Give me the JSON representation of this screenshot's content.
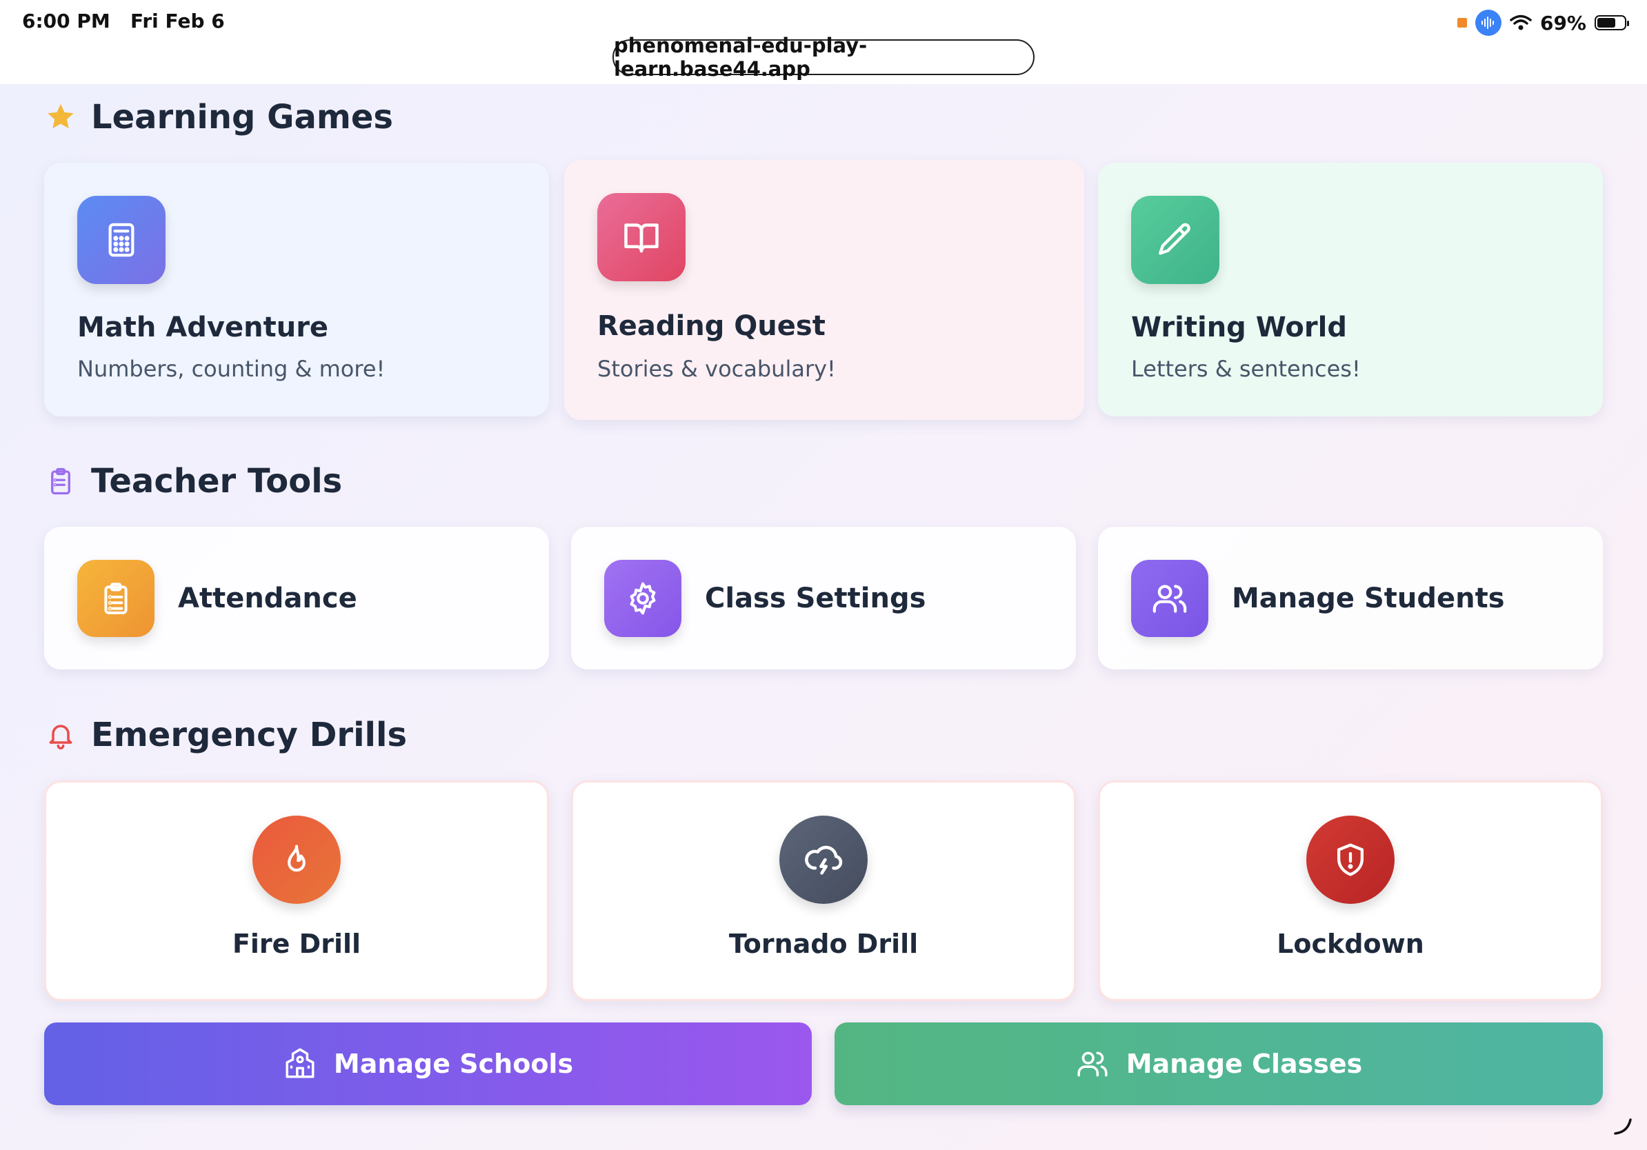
{
  "status_bar": {
    "time": "6:00 PM",
    "date": "Fri Feb 6",
    "battery": "69%",
    "battery_level": 0.69
  },
  "browser": {
    "url": "phenomenal-edu-play-learn.base44.app"
  },
  "sections": {
    "learning_games": {
      "title": "Learning Games",
      "icon": "star-icon",
      "cards": [
        {
          "title": "Math Adventure",
          "subtitle": "Numbers, counting & more!",
          "icon": "calculator-icon",
          "color": "#6d84ee"
        },
        {
          "title": "Reading Quest",
          "subtitle": "Stories & vocabulary!",
          "icon": "book-open-icon",
          "color": "#e45378"
        },
        {
          "title": "Writing World",
          "subtitle": "Letters & sentences!",
          "icon": "pencil-icon",
          "color": "#4fbf92"
        }
      ]
    },
    "teacher_tools": {
      "title": "Teacher Tools",
      "icon": "clipboard-list-icon",
      "cards": [
        {
          "title": "Attendance",
          "icon": "clipboard-icon",
          "color": "#f2a33a"
        },
        {
          "title": "Class Settings",
          "icon": "gear-icon",
          "color": "#9b6cf0"
        },
        {
          "title": "Manage Students",
          "icon": "users-icon",
          "color": "#8b63ee"
        }
      ]
    },
    "emergency_drills": {
      "title": "Emergency Drills",
      "icon": "bell-icon",
      "cards": [
        {
          "title": "Fire Drill",
          "icon": "flame-icon",
          "color": "#e8603d"
        },
        {
          "title": "Tornado Drill",
          "icon": "storm-cloud-icon",
          "color": "#535c6e"
        },
        {
          "title": "Lockdown",
          "icon": "shield-alert-icon",
          "color": "#c72c2c"
        }
      ]
    }
  },
  "actions": {
    "manage_schools": "Manage Schools",
    "manage_classes": "Manage Classes"
  }
}
